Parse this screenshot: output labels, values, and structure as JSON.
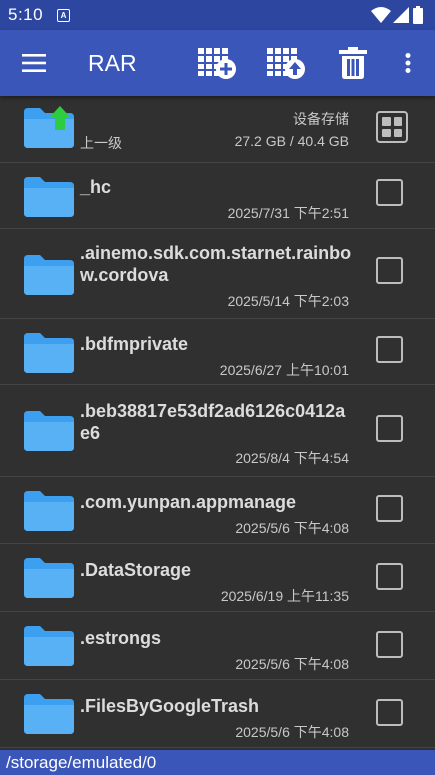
{
  "status": {
    "time": "5:10",
    "notification_badge": "A"
  },
  "toolbar": {
    "title": "RAR",
    "menu_icon": "hamburger-menu-icon",
    "add_archive_icon": "archive-add-icon",
    "extract_icon": "archive-extract-icon",
    "delete_icon": "trash-icon",
    "more_icon": "more-vertical-icon"
  },
  "parent": {
    "label": "上一级",
    "storage_label": "设备存储",
    "storage_size": "27.2 GB / 40.4 GB"
  },
  "files": [
    {
      "name": "_hc",
      "date": "2025/7/31 下午2:51"
    },
    {
      "name": ".ainemo.sdk.com.starnet.rainbow.cordova",
      "date": "2025/5/14 下午2:03"
    },
    {
      "name": ".bdfmprivate",
      "date": "2025/6/27 上午10:01"
    },
    {
      "name": ".beb38817e53df2ad6126c0412ae6",
      "date": "2025/8/4 下午4:54"
    },
    {
      "name": ".com.yunpan.appmanage",
      "date": "2025/5/6 下午4:08"
    },
    {
      "name": ".DataStorage",
      "date": "2025/6/19 上午11:35"
    },
    {
      "name": ".estrongs",
      "date": "2025/5/6 下午4:08"
    },
    {
      "name": ".FilesByGoogleTrash",
      "date": "2025/5/6 下午4:08"
    }
  ],
  "path": "/storage/emulated/0",
  "colors": {
    "appbar": "#3a56b8",
    "statusbar": "#2d47a0",
    "folder": "#3d9ff0",
    "up_arrow": "#2ecc40",
    "background": "#303030"
  }
}
